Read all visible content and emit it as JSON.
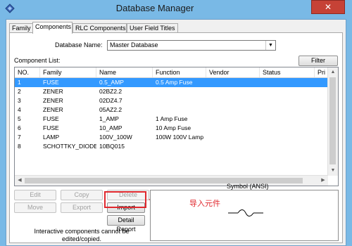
{
  "window": {
    "title": "Database Manager",
    "close_glyph": "✕",
    "app_icon": "multisim-app-icon"
  },
  "tabs": [
    {
      "label": "Family"
    },
    {
      "label": "Components"
    },
    {
      "label": "RLC Components"
    },
    {
      "label": "User Field Titles"
    }
  ],
  "database": {
    "label": "Database Name:",
    "value": "Master Database"
  },
  "component_list": {
    "label": "Component List:",
    "filter_button": "Filter",
    "columns": [
      "NO.",
      "Family",
      "Name",
      "Function",
      "Vendor",
      "Status",
      "Pri"
    ],
    "rows": [
      [
        "1",
        "FUSE",
        "0.5_AMP",
        "0.5 Amp Fuse",
        "",
        "",
        ""
      ],
      [
        "2",
        "ZENER",
        "02BZ2.2",
        "",
        "",
        "",
        ""
      ],
      [
        "3",
        "ZENER",
        "02DZ4.7",
        "",
        "",
        "",
        ""
      ],
      [
        "4",
        "ZENER",
        "05AZ2.2",
        "",
        "",
        "",
        ""
      ],
      [
        "5",
        "FUSE",
        "1_AMP",
        "1 Amp Fuse",
        "",
        "",
        ""
      ],
      [
        "6",
        "FUSE",
        "10_AMP",
        "10 Amp Fuse",
        "",
        "",
        ""
      ],
      [
        "7",
        "LAMP",
        "100V_100W",
        "100W 100V Lamp",
        "",
        "",
        ""
      ],
      [
        "8",
        "SCHOTTKY_DIODE",
        "10BQ015",
        "",
        "",
        "",
        ""
      ]
    ],
    "selected_index": 0
  },
  "actions": {
    "edit": "Edit",
    "copy": "Copy",
    "delete": "Delete",
    "move": "Move",
    "export": "Export",
    "import": "Import",
    "detail_report": "Detail Report"
  },
  "symbol": {
    "title": "Symbol (ANSI)"
  },
  "annotation": {
    "text": "导入元件"
  },
  "note": "Interactive components cannot be edited/copied.",
  "colors": {
    "title_bar": "#79b9e6",
    "selection": "#3399ff",
    "annotation": "#e0282e",
    "close": "#c64236"
  }
}
